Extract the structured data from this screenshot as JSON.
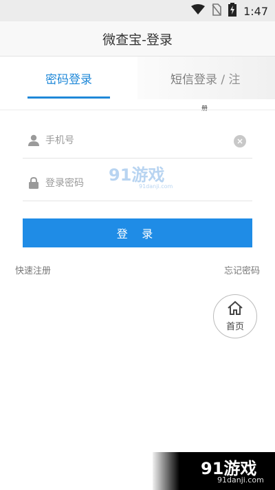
{
  "status_bar": {
    "time": "1:47",
    "icons": [
      "wifi-icon",
      "no-sim-icon",
      "battery-charging-icon"
    ]
  },
  "header": {
    "title": "微查宝-登录"
  },
  "tabs": {
    "password_login": "密码登录",
    "sms_login": "短信登录 / 注",
    "sms_login_overflow": "册"
  },
  "form": {
    "phone_placeholder": "手机号",
    "password_placeholder": "登录密码",
    "submit_label": "登 录"
  },
  "links": {
    "register": "快速注册",
    "forgot_password": "忘记密码"
  },
  "home_button": {
    "label": "首页",
    "icon": "home-icon"
  },
  "watermarks": {
    "center_logo": "91游戏",
    "center_logo_sub": "91danji.com",
    "corner_logo": "91游戏",
    "corner_logo_sub": "91danji.com"
  },
  "colors": {
    "accent": "#1f88d8",
    "button": "#1f8ce6",
    "header_bg": "#f8f8f8",
    "status_bg": "#ececec"
  }
}
